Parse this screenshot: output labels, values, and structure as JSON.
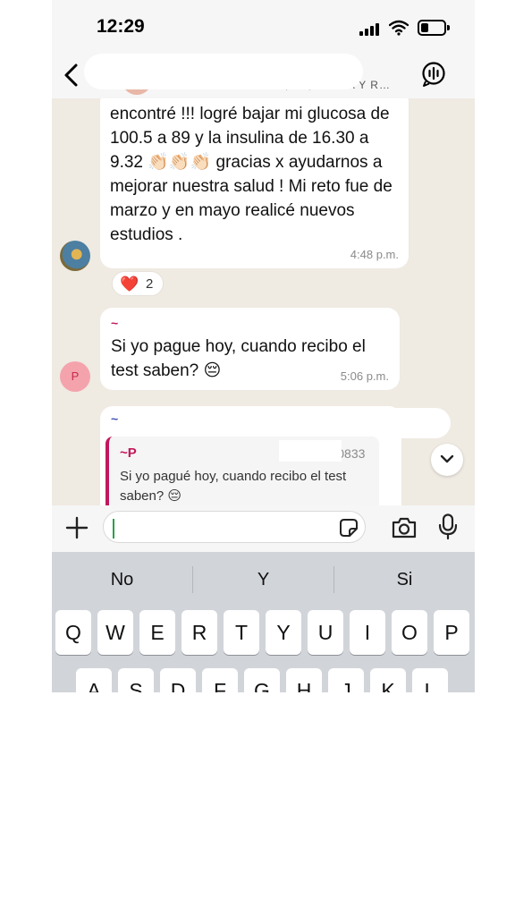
{
  "status_bar": {
    "time": "12:29"
  },
  "header": {
    "subtitle": "…, ~A, ~A M A Y R…"
  },
  "messages": [
    {
      "text": "encontré !!! logré bajar mi glucosa de 100.5 a 89 y la insulina de 16.30 a 9.32 👏🏻👏🏻👏🏻 gracias x ayudarnos a mejorar nuestra salud ! Mi reto fue de marzo y en mayo realicé nuevos estudios .",
      "time": "4:48 p.m.",
      "reaction": {
        "emoji": "❤️",
        "count": "2"
      }
    },
    {
      "sender": "~",
      "avatar_letter": "P",
      "text": "Si yo pague hoy, cuando recibo el test saben? 😔",
      "time": "5:06 p.m."
    },
    {
      "sender": "~",
      "quoted": {
        "sender": "~P",
        "phone": "256 0833",
        "text": "Si yo pagué hoy, cuando recibo el test saben? 😔"
      }
    }
  ],
  "keyboard": {
    "suggestions": [
      "No",
      "Y",
      "Si"
    ],
    "row1": [
      "Q",
      "W",
      "E",
      "R",
      "T",
      "Y",
      "U",
      "I",
      "O",
      "P"
    ],
    "row2": [
      "A",
      "S",
      "D",
      "F",
      "G",
      "H",
      "J",
      "K",
      "L"
    ]
  },
  "colors": {
    "chat_background": "#efeae2",
    "bubble": "#ffffff",
    "reply_sender": "#c2185b",
    "cursor_green": "#25a244"
  }
}
